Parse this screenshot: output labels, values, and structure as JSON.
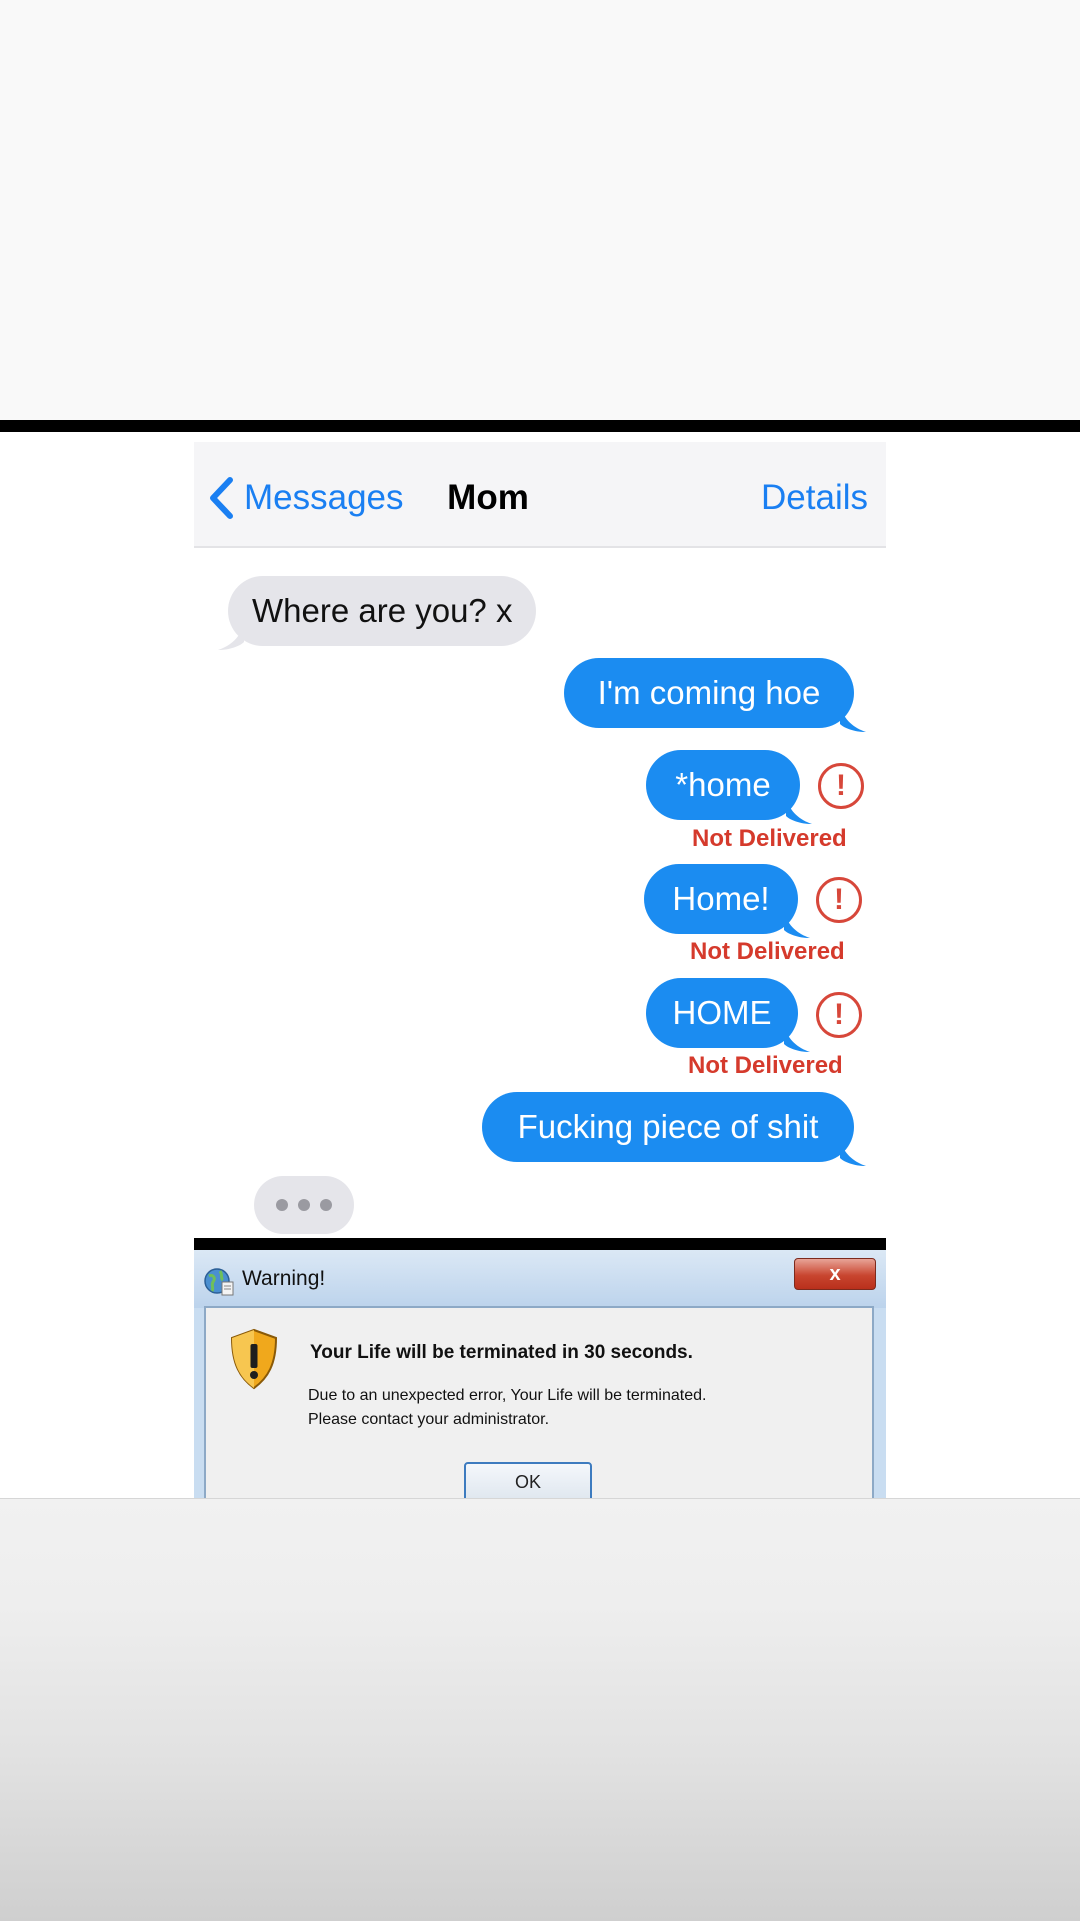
{
  "header": {
    "back_label": "Messages",
    "contact_name": "Mom",
    "details_label": "Details"
  },
  "messages": [
    {
      "direction": "incoming",
      "text": "Where are you? x"
    },
    {
      "direction": "outgoing",
      "text": "I'm coming hoe"
    },
    {
      "direction": "outgoing",
      "text": "*home",
      "status": "Not Delivered"
    },
    {
      "direction": "outgoing",
      "text": "Home!",
      "status": "Not Delivered"
    },
    {
      "direction": "outgoing",
      "text": "HOME",
      "status": "Not Delivered"
    },
    {
      "direction": "outgoing",
      "text": "Fucking piece of shit"
    }
  ],
  "error_glyph": "!",
  "dialog": {
    "title": "Warning!",
    "close_label": "x",
    "heading": "Your Life will be terminated in 30 seconds.",
    "message_line1": "Due to an unexpected error, Your Life will be terminated.",
    "message_line2": "Please contact your administrator.",
    "ok_label": "OK"
  },
  "colors": {
    "ios_blue": "#1a7ff2",
    "bubble_blue": "#1b8cf1",
    "bubble_gray": "#e5e5ea",
    "error_red": "#d53a2c"
  }
}
